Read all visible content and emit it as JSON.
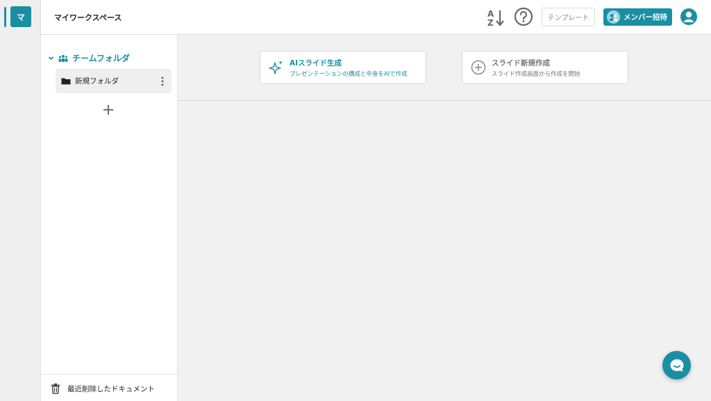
{
  "rail": {
    "workspace_initial": "マ"
  },
  "topbar": {
    "workspace_title": "マイワークスペース",
    "template_label": "テンプレート",
    "invite_label": "メンバー招待"
  },
  "sidebar": {
    "team_folder_label": "チームフォルダ",
    "folders": [
      {
        "label": "新規フォルダ"
      }
    ],
    "trash_label": "最近削除したドキュメント"
  },
  "main": {
    "ai_card": {
      "title": "AIスライド生成",
      "subtitle": "プレゼンテーションの構成と中身をAIで作成"
    },
    "new_card": {
      "title": "スライド新規作成",
      "subtitle": "スライド作成画面から作成を開始"
    }
  },
  "colors": {
    "accent": "#1a8fa3",
    "muted": "#777777"
  },
  "icons": [
    "sort-az-icon",
    "help-icon",
    "user-avatar-icon",
    "team-icon",
    "folder-icon",
    "more-vertical-icon",
    "plus-icon",
    "trash-icon",
    "sparkle-icon",
    "plus-circle-icon",
    "chat-icon",
    "chevron-down-icon"
  ]
}
